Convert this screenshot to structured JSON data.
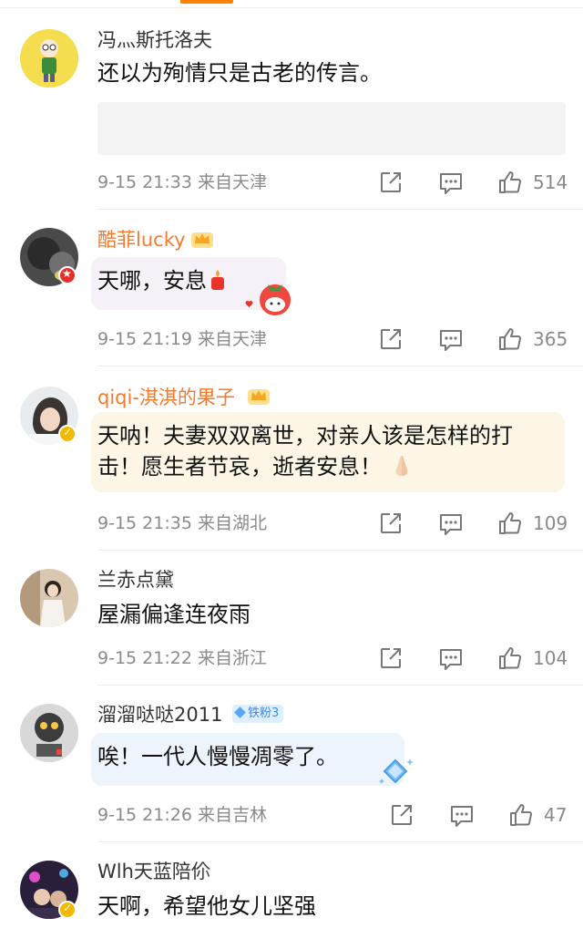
{
  "comments": [
    {
      "username": "冯灬斯托洛夫",
      "text": "还以为殉情只是古老的传言。",
      "date": "9-15 21:33",
      "location": "来自天津",
      "likes": "514"
    },
    {
      "username": "酷菲lucky",
      "text": "天哪，安息",
      "date": "9-15 21:19",
      "location": "来自天津",
      "likes": "365"
    },
    {
      "username": "qiqi-淇淇的果子",
      "text_line1": "天呐！夫妻双双离世，对亲人该是怎样的打",
      "text_line2": "击！愿生者节哀，逝者安息！",
      "date": "9-15 21:35",
      "location": "来自湖北",
      "likes": "109"
    },
    {
      "username": "兰赤点黛",
      "text": "屋漏偏逢连夜雨",
      "date": "9-15 21:22",
      "location": "来自浙江",
      "likes": "104"
    },
    {
      "username": "溜溜哒哒2011",
      "fan_badge": "铁粉3",
      "text": "唉！一代人慢慢凋零了。",
      "date": "9-15 21:26",
      "location": "来自吉林",
      "likes": "47"
    },
    {
      "username": "Wlh天蓝陪伱",
      "text": "天啊，希望他女儿坚强"
    }
  ],
  "colors": {
    "accent": "#ff8200",
    "vip_name": "#f7792a",
    "meta": "#8a8a8a",
    "text": "#111111"
  },
  "icons": [
    "share-icon",
    "comment-icon",
    "like-icon",
    "candle-emoji",
    "praying-hands-emoji",
    "crown-icon",
    "verified-icon"
  ]
}
